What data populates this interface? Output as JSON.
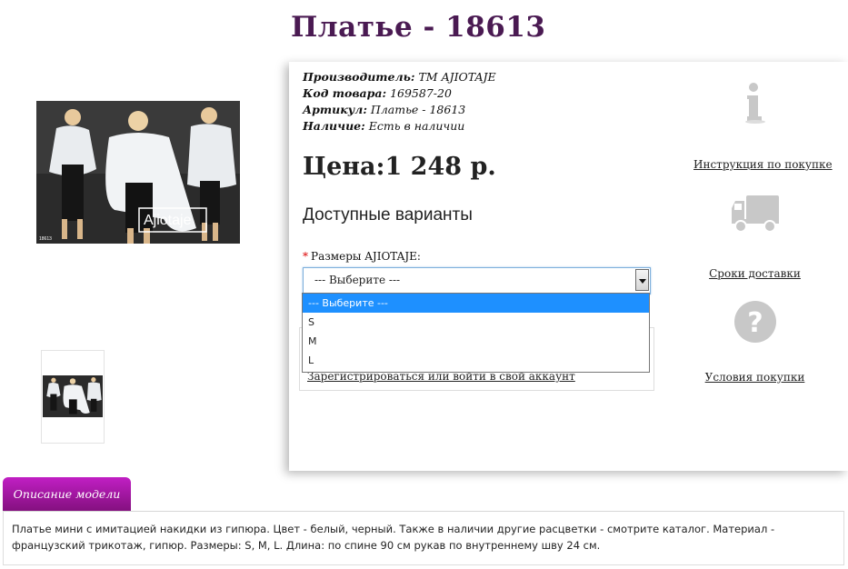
{
  "product": {
    "title": "Платье - 18613",
    "specs": {
      "manufacturer_label": "Производитель:",
      "manufacturer_value": "ТМ AJIOTAJE",
      "code_label": "Код товара:",
      "code_value": "169587-20",
      "article_label": "Артикул:",
      "article_value": "Платье - 18613",
      "stock_label": "Наличие:",
      "stock_value": "Есть в наличии"
    },
    "price": "Цена:1 248 р.",
    "variants_heading": "Доступные варианты",
    "size_label": "Размеры AJIOTAJE:",
    "size_required_mark": "*",
    "size_select_value": "--- Выберите ---",
    "size_options": [
      "--- Выберите ---",
      "S",
      "M",
      "L"
    ],
    "login_link": "Зарегистрироваться или войти в свой аккаунт",
    "photo_brand": "Ajiotaje",
    "photo_code": "18613"
  },
  "side_links": {
    "instructions": "Инструкция по покупке",
    "delivery": "Сроки доставки",
    "terms": "Условия покупки"
  },
  "tabs": {
    "description_tab": "Описание модели"
  },
  "description": "Платье мини с имитацией накидки из гипюра. Цвет - белый, черный. Также в наличии другие расцветки - смотрите каталог. Материал - французский трикотаж, гипюр. Размеры: S, M, L. Длина: по спине 90 см рукав по внутреннему шву 24 см.",
  "colors": {
    "title": "#4a1a52",
    "tab_top": "#c11fc4",
    "tab_bottom": "#84107f",
    "selected_option": "#1e90ff",
    "icon_gray": "#c8c8c8"
  },
  "icons": {
    "instructions": "info-icon",
    "delivery": "truck-icon",
    "terms": "question-icon"
  }
}
